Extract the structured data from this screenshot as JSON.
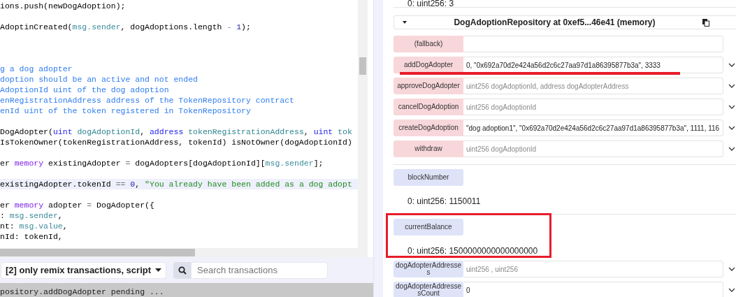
{
  "editor": {
    "lines": [
      {
        "tokens": [
          {
            "kind": "plain",
            "text": "ions.push(newDogAdoption);"
          }
        ]
      },
      {
        "kind": "blank"
      },
      {
        "tokens": [
          {
            "kind": "plain",
            "text": "AdoptinCreated("
          },
          {
            "kind": "builtin",
            "text": "msg.sender"
          },
          {
            "kind": "plain",
            "text": ", dogAdoptions.length "
          },
          {
            "kind": "op",
            "text": "-"
          },
          {
            "kind": "number",
            "text": " 1"
          },
          {
            "kind": "plain",
            "text": ");"
          }
        ]
      },
      {
        "kind": "blank"
      },
      {
        "kind": "blank"
      },
      {
        "kind": "blank"
      },
      {
        "tokens": [
          {
            "kind": "comment",
            "text": "g a dog adopter"
          }
        ]
      },
      {
        "tokens": [
          {
            "kind": "comment",
            "text": "doption should be an active and not ended"
          }
        ]
      },
      {
        "tokens": [
          {
            "kind": "comment",
            "text": "AdoptionId uint of the dog adoption"
          }
        ]
      },
      {
        "tokens": [
          {
            "kind": "comment",
            "text": "enRegistrationAddress address of the TokenRepository contract"
          }
        ]
      },
      {
        "tokens": [
          {
            "kind": "comment",
            "text": "enId uint of the token registered in TokenRepository"
          }
        ]
      },
      {
        "kind": "blank"
      },
      {
        "tokens": [
          {
            "kind": "plain",
            "text": "DogAdopter("
          },
          {
            "kind": "keyword",
            "text": "uint"
          },
          {
            "kind": "param",
            "text": " dogAdoptionId"
          },
          {
            "kind": "plain",
            "text": ", "
          },
          {
            "kind": "keyword",
            "text": "address"
          },
          {
            "kind": "param",
            "text": " tokenRegistrationAddress"
          },
          {
            "kind": "plain",
            "text": ", "
          },
          {
            "kind": "keyword",
            "text": "uint"
          },
          {
            "kind": "param",
            "text": " tok"
          }
        ]
      },
      {
        "tokens": [
          {
            "kind": "plain",
            "text": "IsTokenOwner(tokenRegistrationAddress, tokenId) isNotOwner(dogAdoptionId)"
          }
        ]
      },
      {
        "kind": "blank"
      },
      {
        "tokens": [
          {
            "kind": "plain",
            "text": "er "
          },
          {
            "kind": "storage",
            "text": "memory"
          },
          {
            "kind": "plain",
            "text": " existingAdopter "
          },
          {
            "kind": "op",
            "text": "="
          },
          {
            "kind": "plain",
            "text": " dogAdopters[dogAdoptionId]["
          },
          {
            "kind": "builtin",
            "text": "msg.sender"
          },
          {
            "kind": "plain",
            "text": "];"
          }
        ]
      },
      {
        "kind": "blank"
      },
      {
        "current": true,
        "tokens": [
          {
            "kind": "plain",
            "text": "existingAdopter.tokenId "
          },
          {
            "kind": "op",
            "text": "=="
          },
          {
            "kind": "number",
            "text": " 0"
          },
          {
            "kind": "plain",
            "text": ", "
          },
          {
            "kind": "string",
            "text": "\"You already have been added as a dog adopt"
          }
        ]
      },
      {
        "kind": "blank"
      },
      {
        "tokens": [
          {
            "kind": "plain",
            "text": "er "
          },
          {
            "kind": "storage",
            "text": "memory"
          },
          {
            "kind": "plain",
            "text": " adopter "
          },
          {
            "kind": "op",
            "text": "="
          },
          {
            "kind": "plain",
            "text": " DogAdopter({"
          }
        ]
      },
      {
        "tokens": [
          {
            "kind": "plain",
            "text": ": "
          },
          {
            "kind": "builtin",
            "text": "msg.sender"
          },
          {
            "kind": "plain",
            "text": ","
          }
        ]
      },
      {
        "tokens": [
          {
            "kind": "plain",
            "text": "nt: "
          },
          {
            "kind": "builtin",
            "text": "msg.value"
          },
          {
            "kind": "plain",
            "text": ","
          }
        ]
      },
      {
        "tokens": [
          {
            "kind": "plain",
            "text": "nId: tokenId,"
          }
        ]
      }
    ]
  },
  "terminal": {
    "filter": "[2] only remix transactions, script",
    "search": {
      "placeholder": "Search transactions"
    },
    "log": "pository.addDogAdopter pending ..."
  },
  "contract": {
    "previous_result": "0: uint256: 3",
    "title": "DogAdoptionRepository at 0xef5...46e41 (memory)",
    "functions": [
      {
        "kind": "fallback",
        "label": "(fallback)"
      },
      {
        "kind": "transact",
        "label": "addDogAdopter",
        "value": "0, \"0x692a70d2e424a56d2c6c27aa97d1a86395877b3a\", 3333",
        "underlined": true
      },
      {
        "kind": "transact",
        "label": "approveDogAdopter",
        "placeholder": "uint256 dogAdoptionId, address dogAdopterAddress"
      },
      {
        "kind": "transact",
        "label": "cancelDogAdoption",
        "placeholder": "uint256 dogAdoptionId"
      },
      {
        "kind": "transact",
        "label": "createDogAdoption",
        "value": "\"dog adoption1\", \"0x692a70d2e424a56d2c6c27aa97d1a86395877b3a\", 1111, 116"
      },
      {
        "kind": "transact",
        "label": "withdraw",
        "placeholder": "uint256 dogAdoptionId"
      },
      {
        "kind": "call",
        "label": "blockNumber",
        "result": "0: uint256: 1150011"
      },
      {
        "kind": "call",
        "label": "currentBalance",
        "result": "0: uint256: 1500000000000000000",
        "framed": true
      },
      {
        "kind": "call",
        "label": "dogAdopterAddresses",
        "placeholder": "uint256 , uint256"
      },
      {
        "kind": "call",
        "label": "dogAdopterAddressesCount",
        "value": "0"
      }
    ]
  }
}
